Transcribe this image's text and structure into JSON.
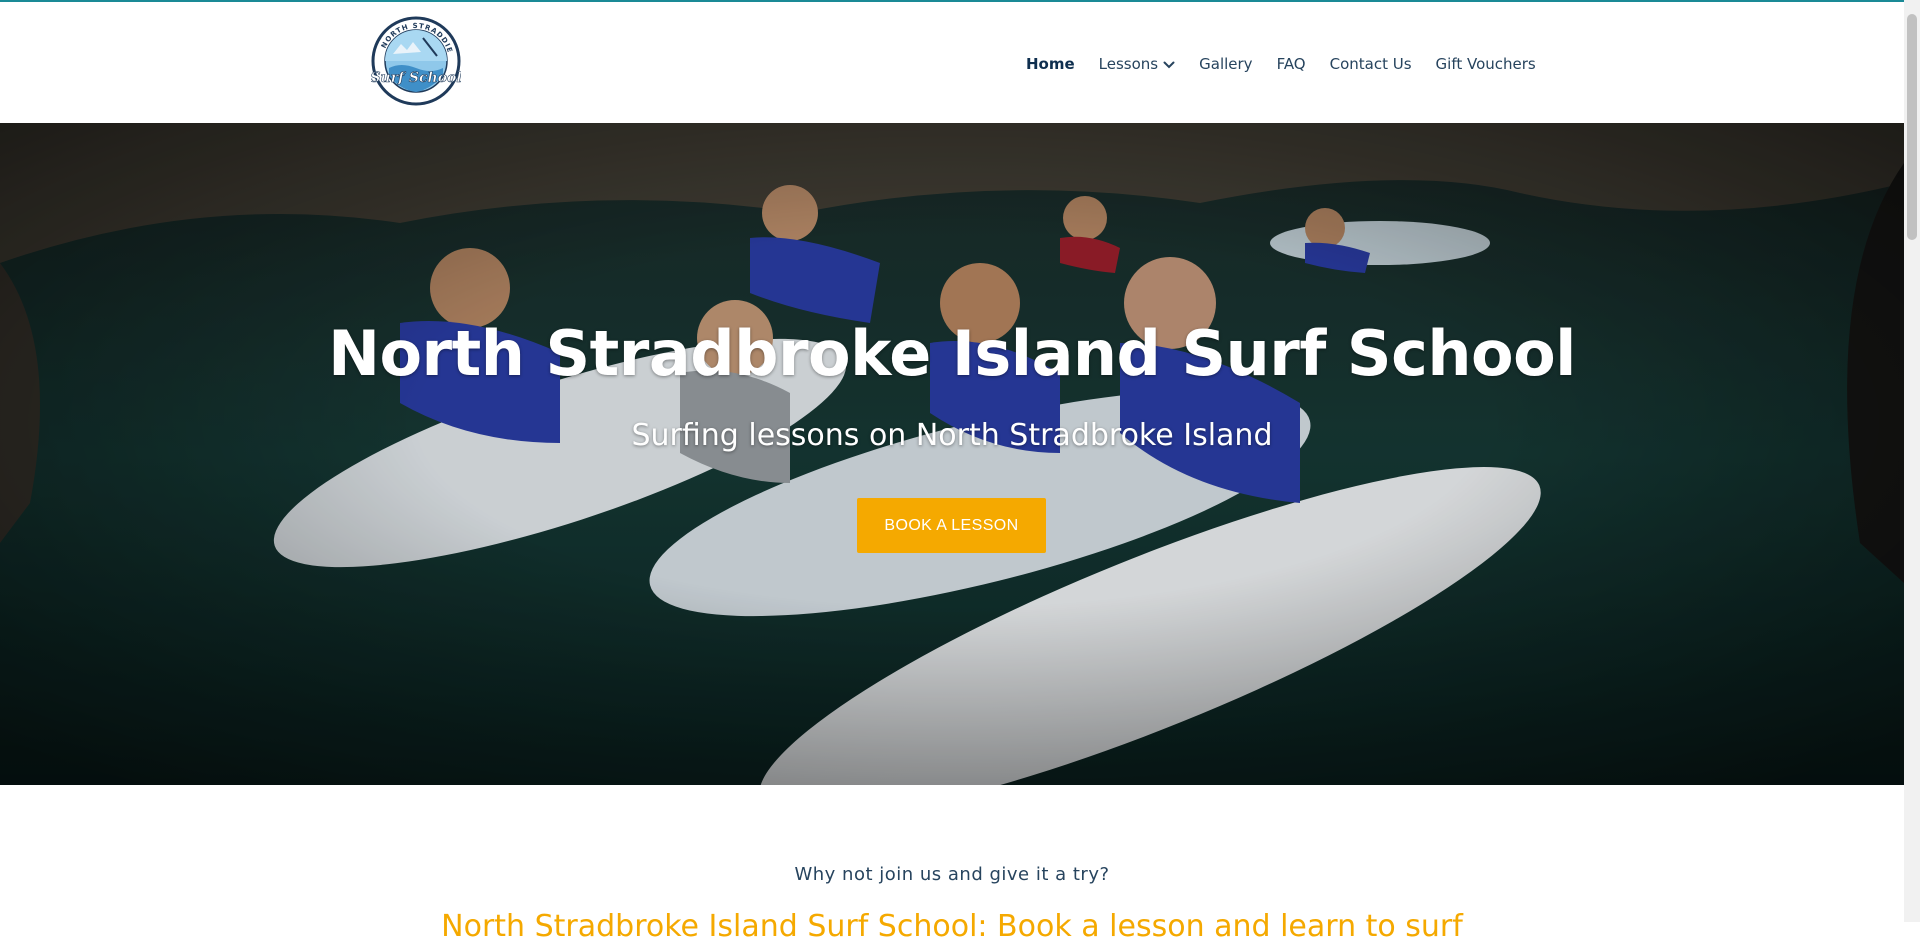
{
  "brand": {
    "logo_text": "NORTH STRADDIE Surf School",
    "accent": "#f5a900",
    "nav_color": "#27445e",
    "top_line_color": "#1a8a96"
  },
  "nav": {
    "items": [
      {
        "label": "Home",
        "active": true
      },
      {
        "label": "Lessons",
        "has_dropdown": true
      },
      {
        "label": "Gallery"
      },
      {
        "label": "FAQ"
      },
      {
        "label": "Contact Us"
      },
      {
        "label": "Gift Vouchers"
      }
    ]
  },
  "hero": {
    "title": "North Stradbroke Island Surf School",
    "subtitle": "Surfing lessons on North Stradbroke Island",
    "cta_label": "BOOK A LESSON"
  },
  "content": {
    "tagline": "Why not join us and give it a try?",
    "intro_heading": "North Stradbroke Island Surf School: Book a lesson and learn to surf"
  }
}
